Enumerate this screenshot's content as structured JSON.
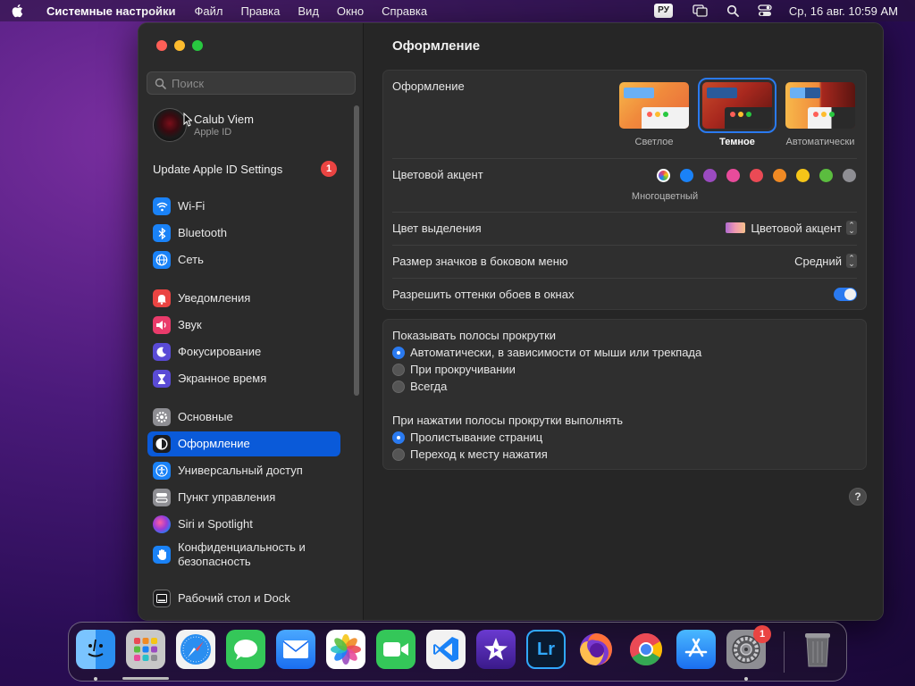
{
  "menubar": {
    "app_name": "Системные настройки",
    "menus": [
      "Файл",
      "Правка",
      "Вид",
      "Окно",
      "Справка"
    ],
    "input_lang": "РУ",
    "clock": "Ср, 16 авг.  10:59 AM"
  },
  "sidebar": {
    "search_placeholder": "Поиск",
    "account": {
      "name": "Calub Viem",
      "subtitle": "Apple ID"
    },
    "update": {
      "label": "Update Apple ID Settings",
      "badge": "1"
    },
    "items": [
      {
        "label": "Wi-Fi",
        "icon": "wifi-icon",
        "color": "#1a82f7"
      },
      {
        "label": "Bluetooth",
        "icon": "bluetooth-icon",
        "color": "#1a82f7"
      },
      {
        "label": "Сеть",
        "icon": "globe-icon",
        "color": "#1a82f7"
      },
      {
        "label": "Уведомления",
        "icon": "bell-icon",
        "color": "#ea4442"
      },
      {
        "label": "Звук",
        "icon": "speaker-icon",
        "color": "#ea3b6b"
      },
      {
        "label": "Фокусирование",
        "icon": "moon-icon",
        "color": "#5a4bd6"
      },
      {
        "label": "Экранное время",
        "icon": "hourglass-icon",
        "color": "#5a4bd6"
      },
      {
        "label": "Основные",
        "icon": "gear-icon",
        "color": "#8e8e93"
      },
      {
        "label": "Оформление",
        "icon": "appearance-icon",
        "color": "#1c1c1e"
      },
      {
        "label": "Универсальный доступ",
        "icon": "accessibility-icon",
        "color": "#1a82f7"
      },
      {
        "label": "Пункт управления",
        "icon": "control-center-icon",
        "color": "#8e8e93"
      },
      {
        "label": "Siri и Spotlight",
        "icon": "siri-icon",
        "color": "#9b3bd6"
      },
      {
        "label": "Конфиденциальность и безопасность",
        "icon": "hand-icon",
        "color": "#1a82f7"
      },
      {
        "label": "Рабочий стол и Dock",
        "icon": "dock-icon",
        "color": "#1c1c1e"
      }
    ]
  },
  "content": {
    "title": "Оформление",
    "appearance": {
      "label": "Оформление",
      "options": [
        {
          "label": "Светлое",
          "selected": false
        },
        {
          "label": "Темное",
          "selected": true
        },
        {
          "label": "Автоматически",
          "selected": false
        }
      ]
    },
    "accent": {
      "label": "Цветовой акцент",
      "selected_caption": "Многоцветный",
      "colors": [
        "multicolor",
        "#1a82f7",
        "#9b4bc0",
        "#e84b9b",
        "#ea4a55",
        "#f08a24",
        "#f5c518",
        "#5bbd3f",
        "#8e8e93"
      ]
    },
    "highlight": {
      "label": "Цвет выделения",
      "value": "Цветовой акцент"
    },
    "icon_size": {
      "label": "Размер значков в боковом меню",
      "value": "Средний"
    },
    "wallpaper_tint": {
      "label": "Разрешить оттенки обоев в окнах",
      "enabled": true
    },
    "scrollbars": {
      "label": "Показывать полосы прокрутки",
      "options": [
        {
          "label": "Автоматически, в зависимости от мыши или трекпада",
          "selected": true
        },
        {
          "label": "При прокручивании",
          "selected": false
        },
        {
          "label": "Всегда",
          "selected": false
        }
      ]
    },
    "click_scroll": {
      "label": "При нажатии полосы прокрутки выполнять",
      "options": [
        {
          "label": "Пролистывание страниц",
          "selected": true
        },
        {
          "label": "Переход к месту нажатия",
          "selected": false
        }
      ]
    },
    "help": "?"
  },
  "dock": {
    "apps": [
      {
        "name": "finder-icon",
        "running": true
      },
      {
        "name": "launchpad-icon",
        "running": true
      },
      {
        "name": "safari-icon",
        "running": false
      },
      {
        "name": "messages-icon",
        "running": false
      },
      {
        "name": "mail-icon",
        "running": false
      },
      {
        "name": "photos-icon",
        "running": false
      },
      {
        "name": "facetime-icon",
        "running": false
      },
      {
        "name": "vscode-icon",
        "running": false
      },
      {
        "name": "imovie-icon",
        "running": false
      },
      {
        "name": "lightroom-icon",
        "running": false
      },
      {
        "name": "firefox-icon",
        "running": false
      },
      {
        "name": "chrome-icon",
        "running": false
      },
      {
        "name": "appstore-icon",
        "running": false
      },
      {
        "name": "system-settings-icon",
        "running": true,
        "badge": "1"
      }
    ],
    "trash": "trash-icon",
    "lightroom_text": "Lr"
  }
}
